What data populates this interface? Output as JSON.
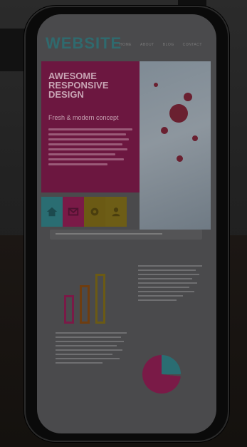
{
  "site": {
    "logo": "WEBSITE",
    "nav": [
      "HOME",
      "ABOUT",
      "BLOG",
      "CONTACT"
    ],
    "hero_title": "AWESOME RESPONSIVE DESIGN",
    "hero_subtitle": "Fresh & modern concept"
  },
  "tiles": [
    {
      "icon": "home-icon",
      "color": "#2a6d72"
    },
    {
      "icon": "mail-icon",
      "color": "#7a1a47"
    },
    {
      "icon": "gear-icon",
      "color": "#6b5a14"
    },
    {
      "icon": "user-icon",
      "color": "#6d5d16"
    }
  ],
  "colors": {
    "teal": "#2f6a6e",
    "magenta": "#6c1740",
    "mustard": "#6b5a14",
    "orange": "#6e3d10"
  }
}
